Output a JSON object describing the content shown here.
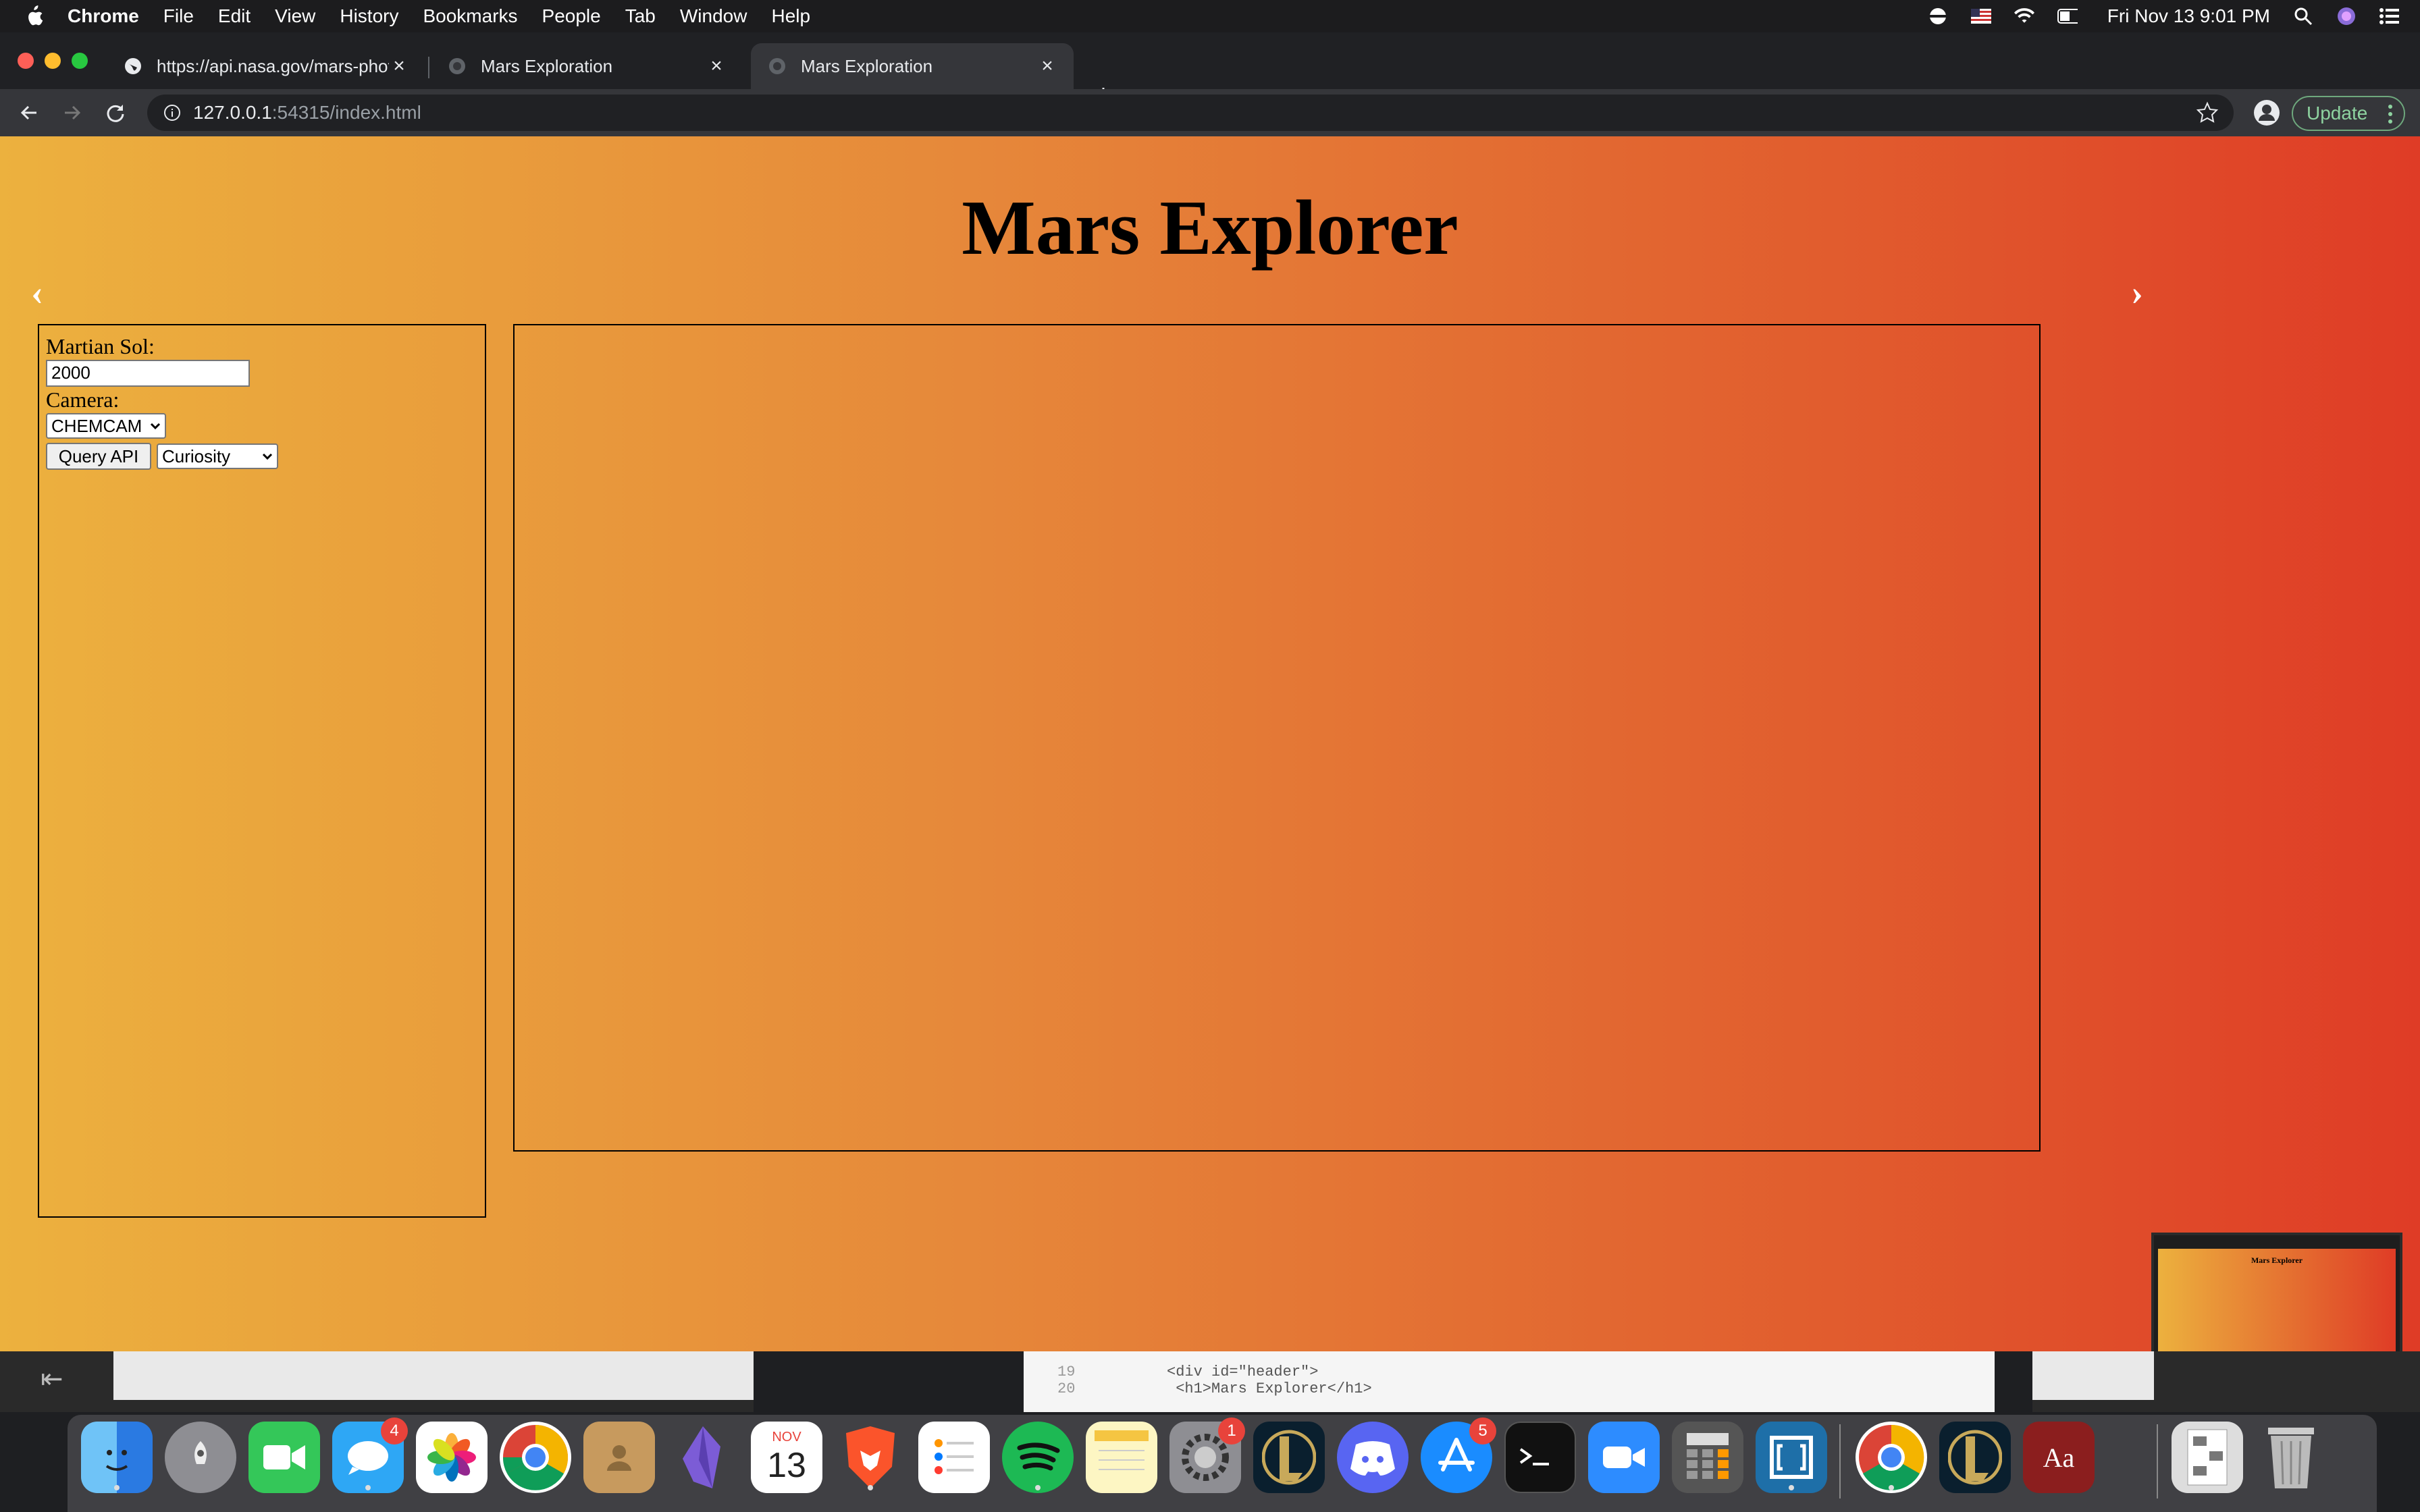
{
  "menubar": {
    "app_name": "Chrome",
    "items": [
      "File",
      "Edit",
      "View",
      "History",
      "Bookmarks",
      "People",
      "Tab",
      "Window",
      "Help"
    ],
    "clock": "Fri Nov 13  9:01 PM"
  },
  "tabs": [
    {
      "title": "https://api.nasa.gov/mars-photos"
    },
    {
      "title": "Mars Exploration"
    },
    {
      "title": "Mars Exploration"
    }
  ],
  "address_bar": {
    "host": "127.0.0.1",
    "path": ":54315/index.html"
  },
  "update_button": "Update",
  "page": {
    "title": "Mars Explorer",
    "prev_arrow": "‹",
    "next_arrow": "›",
    "form": {
      "sol_label": "Martian Sol:",
      "sol_value": "2000",
      "camera_label": "Camera:",
      "camera_selected": "CHEMCAM",
      "query_button": "Query API",
      "rover_selected": "Curiosity"
    }
  },
  "thumbnail_title": "Mars Explorer",
  "background_editor": {
    "lines": [
      {
        "num": "19",
        "code": "<div id=\"header\">"
      },
      {
        "num": "20",
        "code": "    <h1>Mars Explorer</h1>"
      }
    ]
  },
  "dock": {
    "messages_badge": "4",
    "calendar_month": "NOV",
    "calendar_day": "13",
    "system_prefs_badge": "1",
    "app_store_badge": "5",
    "dictionary_label": "Aa"
  }
}
